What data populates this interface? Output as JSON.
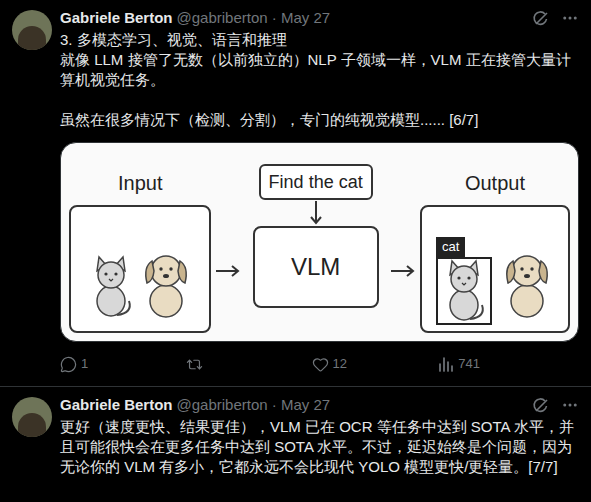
{
  "tweets": [
    {
      "name": "Gabriele Berton",
      "meta": "@gabriberton · May 27",
      "lines": [
        "3. 多模态学习、视觉、语言和推理",
        "就像 LLM 接管了无数（以前独立的）NLP 子领域一样，VLM 正在接管大量计算机视觉任务。",
        "",
        "虽然在很多情况下（检测、分割），专门的纯视觉模型...... [6/7]"
      ],
      "image": {
        "input_label": "Input",
        "prompt": "Find the cat",
        "model": "VLM",
        "output_label": "Output",
        "box_label": "cat"
      },
      "actions": [
        {
          "kind": "reply",
          "count": "1"
        },
        {
          "kind": "repost",
          "count": ""
        },
        {
          "kind": "like",
          "count": "12"
        },
        {
          "kind": "views",
          "count": "741"
        }
      ]
    },
    {
      "name": "Gabriele Berton",
      "meta": "@gabriberton · May 27",
      "lines": [
        "更好（速度更快、结果更佳），VLM 已在 OCR 等任务中达到 SOTA 水平，并且可能很快会在更多任务中达到 SOTA 水平。不过，延迟始终是个问题，因为无论你的 VLM 有多小，它都永远不会比现代 YOLO 模型更快/更轻量。[7/7]"
      ],
      "image": null,
      "actions": []
    }
  ]
}
